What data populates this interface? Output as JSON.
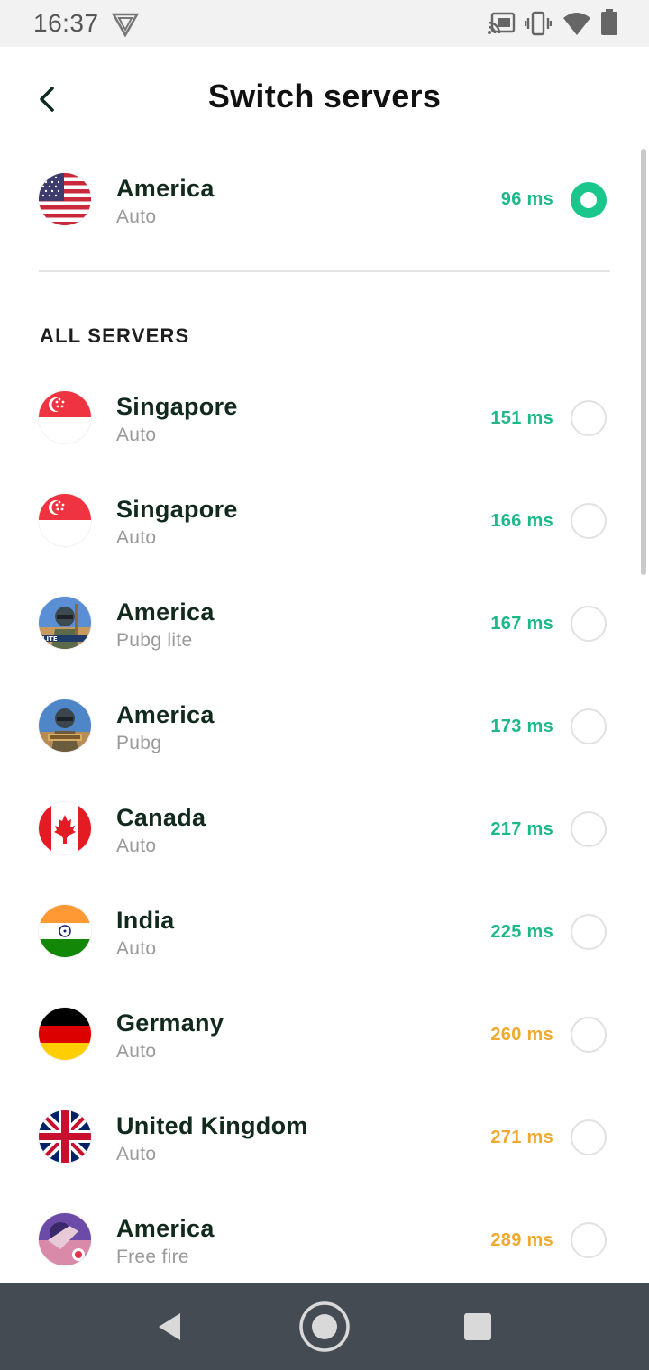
{
  "status_bar": {
    "time": "16:37",
    "icons": [
      "vpn-icon",
      "cast-icon",
      "vibrate-icon",
      "wifi-icon",
      "battery-icon"
    ]
  },
  "header": {
    "title": "Switch servers",
    "back_icon": "back-chevron-icon"
  },
  "selected_server": {
    "name": "America",
    "sub": "Auto",
    "ping": "96 ms",
    "flag": "us-flag-icon",
    "selected": true
  },
  "section_label": "ALL SERVERS",
  "colors": {
    "accent": "#1bc68c",
    "ping_good": "#1bb98a",
    "ping_mid": "#f0a92e",
    "nav_bar": "#454b52"
  },
  "servers": [
    {
      "name": "Singapore",
      "sub": "Auto",
      "ping": "151 ms",
      "flag": "singapore-flag-icon",
      "status": "good"
    },
    {
      "name": "Singapore",
      "sub": "Auto",
      "ping": "166 ms",
      "flag": "singapore-flag-icon",
      "status": "good"
    },
    {
      "name": "America",
      "sub": "Pubg lite",
      "ping": "167 ms",
      "flag": "pubg-lite-icon",
      "status": "good"
    },
    {
      "name": "America",
      "sub": "Pubg",
      "ping": "173 ms",
      "flag": "pubg-icon",
      "status": "good"
    },
    {
      "name": "Canada",
      "sub": "Auto",
      "ping": "217 ms",
      "flag": "canada-flag-icon",
      "status": "good"
    },
    {
      "name": "India",
      "sub": "Auto",
      "ping": "225 ms",
      "flag": "india-flag-icon",
      "status": "good"
    },
    {
      "name": "Germany",
      "sub": "Auto",
      "ping": "260 ms",
      "flag": "germany-flag-icon",
      "status": "mid"
    },
    {
      "name": "United Kingdom",
      "sub": "Auto",
      "ping": "271 ms",
      "flag": "uk-flag-icon",
      "status": "mid"
    },
    {
      "name": "America",
      "sub": "Free fire",
      "ping": "289 ms",
      "flag": "free-fire-icon",
      "status": "mid"
    }
  ],
  "nav": {
    "icons": [
      "nav-back-icon",
      "nav-home-icon",
      "nav-recents-icon"
    ]
  }
}
